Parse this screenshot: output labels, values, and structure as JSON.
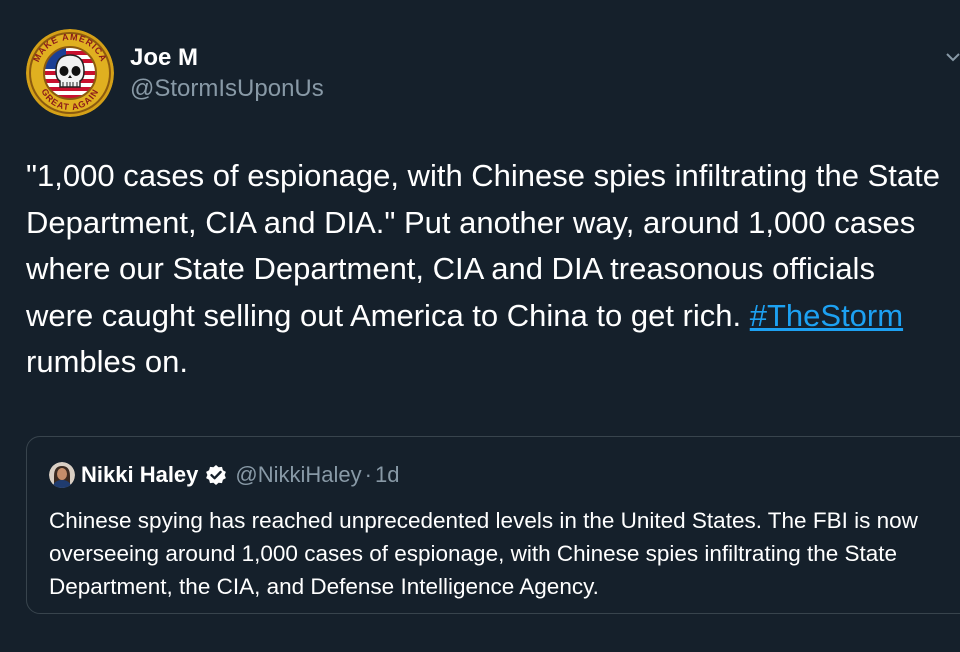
{
  "tweet": {
    "author": {
      "display_name": "Joe M",
      "handle": "@StormIsUponUs",
      "avatar_arc_top": "MAKE AMERICA",
      "avatar_arc_bottom": "GREAT AGAIN"
    },
    "menu_icon": "chevron-down-icon",
    "text_main": "\"1,000 cases of espionage, with Chinese spies infiltrating the State Department, CIA and DIA.\" Put another way, around 1,000 cases where our State Department, CIA and DIA treasonous officials were caught selling out America to China to get rich.",
    "hashtag": "#TheStorm",
    "text_after_hashtag": " rumbles on."
  },
  "quoted_tweet": {
    "display_name": "Nikki Haley",
    "verified_icon": "verified-badge-icon",
    "handle": "@NikkiHaley",
    "separator": "·",
    "time": "1d",
    "text": "Chinese spying has reached unprecedented levels in the United States. The FBI is now overseeing around 1,000 cases of espionage, with Chinese spies infiltrating the State Department, the CIA, and Defense Intelligence Agency."
  },
  "colors": {
    "background": "#15202b",
    "text": "#ffffff",
    "secondary_text": "#8899a6",
    "link": "#1da1f2",
    "border": "#38444d",
    "avatar_gold": "#d4a017"
  }
}
